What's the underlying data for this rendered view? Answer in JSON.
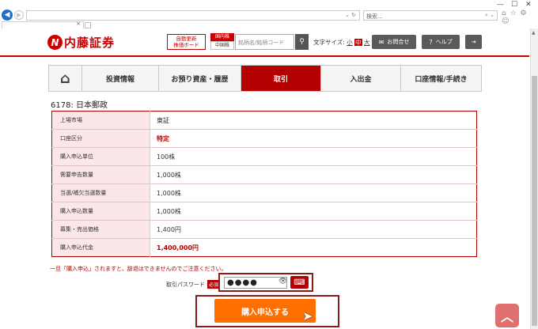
{
  "browser": {
    "search_placeholder": "検索...",
    "window_controls": [
      "—",
      "☐",
      "✕"
    ],
    "toolbar_icons": "⌂ ☆ ⚙ ☺"
  },
  "header": {
    "logo_mark": "N",
    "logo_text": "内藤証券",
    "auto_update_line1": "自動更新",
    "auto_update_line2": "株価ボード",
    "stock_type_top": "国内株",
    "stock_type_bottom": "中国株",
    "code_placeholder": "銘柄名/銘柄コード",
    "font_size_label": "文字サイズ:",
    "font_small": "小",
    "font_medium": "中",
    "font_large": "大",
    "contact_label": "お問合せ",
    "help_label": "ヘルプ",
    "contact_icon": "mail-icon",
    "help_icon": "question-icon",
    "logout_icon": "logout-icon"
  },
  "nav": {
    "home_icon": "home-icon",
    "tabs": [
      "投資情報",
      "お預り資産・履歴",
      "取引",
      "入出金",
      "口座情報/手続き"
    ],
    "active_tab": "取引"
  },
  "stock_title": "6178: 日本郵政",
  "details": [
    {
      "label": "上場市場",
      "value": "東証"
    },
    {
      "label": "口座区分",
      "value": "特定"
    },
    {
      "label": "購入申込単位",
      "value": "100株"
    },
    {
      "label": "需要申告数量",
      "value": "1,000株"
    },
    {
      "label": "当選/補欠当選数量",
      "value": "1,000株"
    },
    {
      "label": "購入申込数量",
      "value": "1,000株"
    },
    {
      "label": "募集・売出価格",
      "value": "1,400円"
    },
    {
      "label": "購入申込代金",
      "value": "1,400,000円"
    }
  ],
  "note": "一旦「購入申込」されますと、辞退はできませんのでご注意ください。",
  "password": {
    "label": "取引パスワード",
    "required": "必須",
    "value": "●●●●"
  },
  "buy_button": "購入申込する",
  "colors": {
    "brand_red": "#cc0000",
    "active_tab": "#b40000",
    "buy_button": "#ff6f00"
  }
}
